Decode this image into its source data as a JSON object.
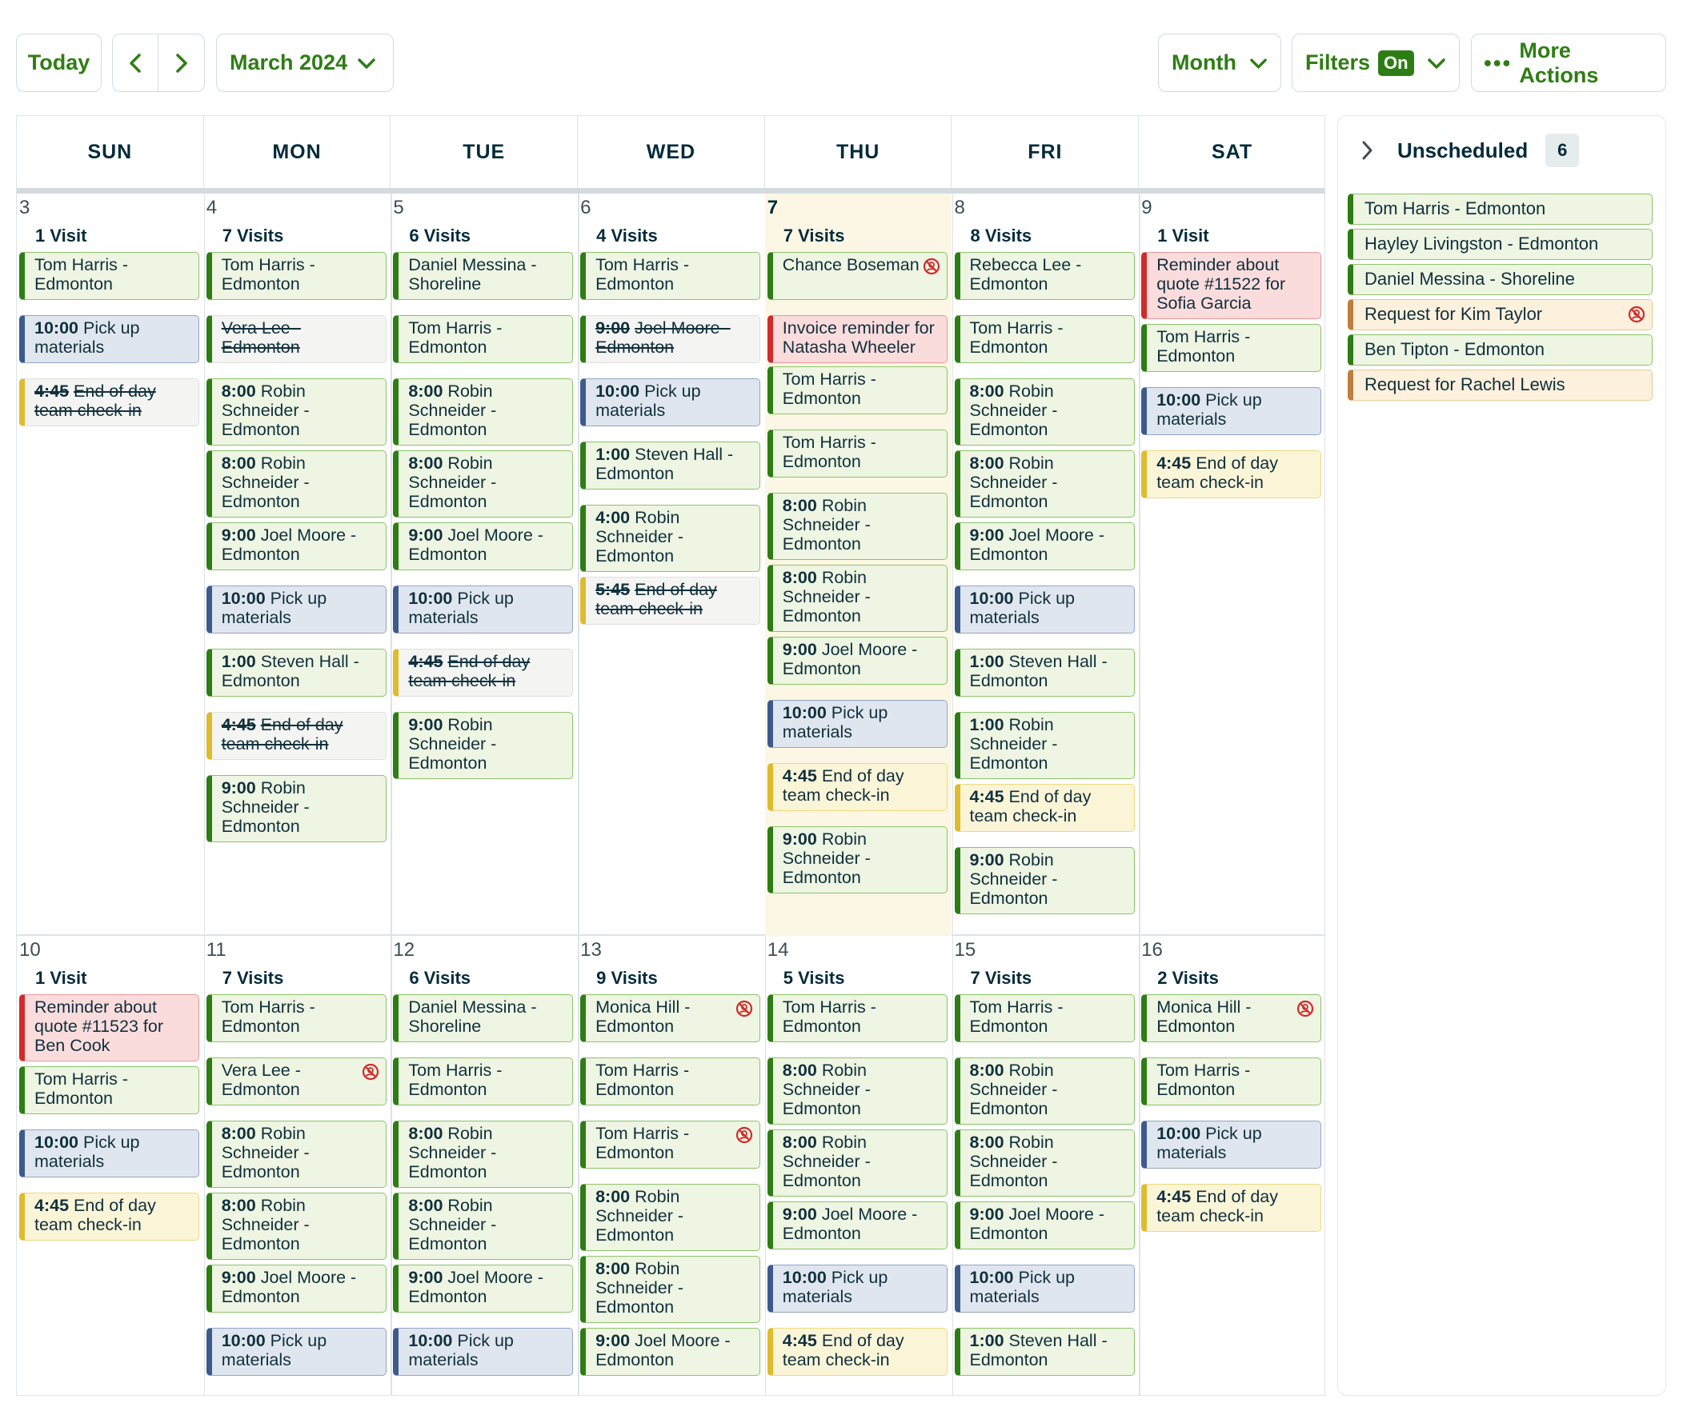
{
  "toolbar": {
    "today_label": "Today",
    "period_label": "March 2024",
    "view_label": "Month",
    "filters_label": "Filters",
    "filters_state": "On",
    "more_actions_label": "More Actions"
  },
  "colors": {
    "brand_green": "#2e7d14",
    "visit_bg": "#eef5e2",
    "task_bg": "#e0e6ef",
    "event_bg": "#fbf5d8",
    "reminder_bg": "#fbdcdc",
    "request_bg": "#fdf0dc"
  },
  "weekdays": [
    "SUN",
    "MON",
    "TUE",
    "WED",
    "THU",
    "FRI",
    "SAT"
  ],
  "weeks": [
    {
      "days": [
        {
          "num": "3",
          "count": "1 Visit",
          "events": [
            {
              "t": "Tom Harris - Edmonton",
              "c": "green"
            },
            {
              "time": "10:00",
              "t": "Pick up materials",
              "c": "blue"
            },
            {
              "time": "4:45",
              "t": "End of day team check-in",
              "c": "gray y",
              "done": true
            }
          ]
        },
        {
          "num": "4",
          "count": "7 Visits",
          "events": [
            {
              "t": "Tom Harris - Edmonton",
              "c": "green"
            },
            {
              "t": "Vera Lee - Edmonton",
              "c": "gray g",
              "done": true
            },
            {
              "time": "8:00",
              "t": "Robin Schneider - Edmonton",
              "c": "green"
            },
            {
              "time": "8:00",
              "t": "Robin Schneider - Edmonton",
              "c": "green"
            },
            {
              "time": "9:00",
              "t": "Joel Moore - Edmonton",
              "c": "green"
            },
            {
              "time": "10:00",
              "t": "Pick up materials",
              "c": "blue"
            },
            {
              "time": "1:00",
              "t": "Steven Hall - Edmonton",
              "c": "green"
            },
            {
              "time": "4:45",
              "t": "End of day team check-in",
              "c": "gray y",
              "done": true
            },
            {
              "time": "9:00",
              "t": "Robin Schneider - Edmonton",
              "c": "green"
            }
          ]
        },
        {
          "num": "5",
          "count": "6 Visits",
          "events": [
            {
              "t": "Daniel Messina - Shoreline",
              "c": "green"
            },
            {
              "t": "Tom Harris - Edmonton",
              "c": "green"
            },
            {
              "time": "8:00",
              "t": "Robin Schneider - Edmonton",
              "c": "green"
            },
            {
              "time": "8:00",
              "t": "Robin Schneider - Edmonton",
              "c": "green"
            },
            {
              "time": "9:00",
              "t": "Joel Moore - Edmonton",
              "c": "green"
            },
            {
              "time": "10:00",
              "t": "Pick up materials",
              "c": "blue"
            },
            {
              "time": "4:45",
              "t": "End of day team check-in",
              "c": "gray y",
              "done": true
            },
            {
              "time": "9:00",
              "t": "Robin Schneider - Edmonton",
              "c": "green"
            }
          ]
        },
        {
          "num": "6",
          "count": "4 Visits",
          "events": [
            {
              "t": "Tom Harris - Edmonton",
              "c": "green"
            },
            {
              "time": "9:00",
              "t": "Joel Moore - Edmonton",
              "c": "gray g",
              "done": true
            },
            {
              "time": "10:00",
              "t": "Pick up materials",
              "c": "blue"
            },
            {
              "time": "1:00",
              "t": "Steven Hall - Edmonton",
              "c": "green"
            },
            {
              "time": "4:00",
              "t": "Robin Schneider - Edmonton",
              "c": "green"
            },
            {
              "time": "5:45",
              "t": "End of day team check-in",
              "c": "gray y",
              "done": true
            }
          ]
        },
        {
          "num": "7",
          "count": "7 Visits",
          "today": true,
          "events": [
            {
              "t": "Chance Boseman",
              "c": "green",
              "unassigned": true
            },
            {
              "t": "Invoice reminder for Natasha Wheeler",
              "c": "red"
            },
            {
              "t": "Tom Harris - Edmonton",
              "c": "green"
            },
            {
              "t": "Tom Harris - Edmonton",
              "c": "green"
            },
            {
              "time": "8:00",
              "t": "Robin Schneider - Edmonton",
              "c": "green"
            },
            {
              "time": "8:00",
              "t": "Robin Schneider - Edmonton",
              "c": "green"
            },
            {
              "time": "9:00",
              "t": "Joel Moore - Edmonton",
              "c": "green"
            },
            {
              "time": "10:00",
              "t": "Pick up materials",
              "c": "blue"
            },
            {
              "time": "4:45",
              "t": "End of day team check-in",
              "c": "yellow"
            },
            {
              "time": "9:00",
              "t": "Robin Schneider - Edmonton",
              "c": "green"
            }
          ]
        },
        {
          "num": "8",
          "count": "8 Visits",
          "events": [
            {
              "t": "Rebecca Lee - Edmonton",
              "c": "green"
            },
            {
              "t": "Tom Harris - Edmonton",
              "c": "green"
            },
            {
              "time": "8:00",
              "t": "Robin Schneider - Edmonton",
              "c": "green"
            },
            {
              "time": "8:00",
              "t": "Robin Schneider - Edmonton",
              "c": "green"
            },
            {
              "time": "9:00",
              "t": "Joel Moore - Edmonton",
              "c": "green"
            },
            {
              "time": "10:00",
              "t": "Pick up materials",
              "c": "blue"
            },
            {
              "time": "1:00",
              "t": "Steven Hall - Edmonton",
              "c": "green"
            },
            {
              "time": "1:00",
              "t": "Robin Schneider - Edmonton",
              "c": "green"
            },
            {
              "time": "4:45",
              "t": "End of day team check-in",
              "c": "yellow"
            },
            {
              "time": "9:00",
              "t": "Robin Schneider - Edmonton",
              "c": "green"
            }
          ]
        },
        {
          "num": "9",
          "count": "1 Visit",
          "events": [
            {
              "t": "Reminder about quote #11522 for Sofia Garcia",
              "c": "red"
            },
            {
              "t": "Tom Harris - Edmonton",
              "c": "green"
            },
            {
              "time": "10:00",
              "t": "Pick up materials",
              "c": "blue"
            },
            {
              "time": "4:45",
              "t": "End of day team check-in",
              "c": "yellow"
            }
          ]
        }
      ]
    },
    {
      "days": [
        {
          "num": "10",
          "count": "1 Visit",
          "events": [
            {
              "t": "Reminder about quote #11523 for Ben Cook",
              "c": "red"
            },
            {
              "t": "Tom Harris - Edmonton",
              "c": "green"
            },
            {
              "time": "10:00",
              "t": "Pick up materials",
              "c": "blue"
            },
            {
              "time": "4:45",
              "t": "End of day team check-in",
              "c": "yellow"
            }
          ]
        },
        {
          "num": "11",
          "count": "7 Visits",
          "events": [
            {
              "t": "Tom Harris - Edmonton",
              "c": "green"
            },
            {
              "t": "Vera Lee - Edmonton",
              "c": "green",
              "unassigned": true
            },
            {
              "time": "8:00",
              "t": "Robin Schneider - Edmonton",
              "c": "green"
            },
            {
              "time": "8:00",
              "t": "Robin Schneider - Edmonton",
              "c": "green"
            },
            {
              "time": "9:00",
              "t": "Joel Moore - Edmonton",
              "c": "green"
            },
            {
              "time": "10:00",
              "t": "Pick up materials",
              "c": "blue"
            }
          ]
        },
        {
          "num": "12",
          "count": "6 Visits",
          "events": [
            {
              "t": "Daniel Messina - Shoreline",
              "c": "green"
            },
            {
              "t": "Tom Harris - Edmonton",
              "c": "green"
            },
            {
              "time": "8:00",
              "t": "Robin Schneider - Edmonton",
              "c": "green"
            },
            {
              "time": "8:00",
              "t": "Robin Schneider - Edmonton",
              "c": "green"
            },
            {
              "time": "9:00",
              "t": "Joel Moore - Edmonton",
              "c": "green"
            },
            {
              "time": "10:00",
              "t": "Pick up materials",
              "c": "blue"
            }
          ]
        },
        {
          "num": "13",
          "count": "9 Visits",
          "events": [
            {
              "t": "Monica Hill - Edmonton",
              "c": "green",
              "unassigned": true
            },
            {
              "t": "Tom Harris - Edmonton",
              "c": "green"
            },
            {
              "t": "Tom Harris - Edmonton",
              "c": "green",
              "unassigned": true
            },
            {
              "time": "8:00",
              "t": "Robin Schneider - Edmonton",
              "c": "green"
            },
            {
              "time": "8:00",
              "t": "Robin Schneider - Edmonton",
              "c": "green"
            },
            {
              "time": "9:00",
              "t": "Joel Moore - Edmonton",
              "c": "green"
            }
          ]
        },
        {
          "num": "14",
          "count": "5 Visits",
          "events": [
            {
              "t": "Tom Harris - Edmonton",
              "c": "green"
            },
            {
              "time": "8:00",
              "t": "Robin Schneider - Edmonton",
              "c": "green"
            },
            {
              "time": "8:00",
              "t": "Robin Schneider - Edmonton",
              "c": "green"
            },
            {
              "time": "9:00",
              "t": "Joel Moore - Edmonton",
              "c": "green"
            },
            {
              "time": "10:00",
              "t": "Pick up materials",
              "c": "blue"
            },
            {
              "time": "4:45",
              "t": "End of day team check-in",
              "c": "yellow"
            }
          ]
        },
        {
          "num": "15",
          "count": "7 Visits",
          "events": [
            {
              "t": "Tom Harris - Edmonton",
              "c": "green"
            },
            {
              "time": "8:00",
              "t": "Robin Schneider - Edmonton",
              "c": "green"
            },
            {
              "time": "8:00",
              "t": "Robin Schneider - Edmonton",
              "c": "green"
            },
            {
              "time": "9:00",
              "t": "Joel Moore - Edmonton",
              "c": "green"
            },
            {
              "time": "10:00",
              "t": "Pick up materials",
              "c": "blue"
            },
            {
              "time": "1:00",
              "t": "Steven Hall - Edmonton",
              "c": "green"
            }
          ]
        },
        {
          "num": "16",
          "count": "2 Visits",
          "events": [
            {
              "t": "Monica Hill - Edmonton",
              "c": "green",
              "unassigned": true
            },
            {
              "t": "Tom Harris - Edmonton",
              "c": "green"
            },
            {
              "time": "10:00",
              "t": "Pick up materials",
              "c": "blue"
            },
            {
              "time": "4:45",
              "t": "End of day team check-in",
              "c": "yellow"
            }
          ]
        }
      ]
    }
  ],
  "unscheduled": {
    "title": "Unscheduled",
    "count": "6",
    "items": [
      {
        "t": "Tom Harris - Edmonton",
        "c": "green"
      },
      {
        "t": "Hayley Livingston - Edmonton",
        "c": "green"
      },
      {
        "t": "Daniel Messina - Shoreline",
        "c": "green"
      },
      {
        "t": "Request for Kim Taylor",
        "c": "orange",
        "unassigned": true
      },
      {
        "t": "Ben Tipton - Edmonton",
        "c": "green"
      },
      {
        "t": "Request for Rachel Lewis",
        "c": "orange"
      }
    ]
  }
}
